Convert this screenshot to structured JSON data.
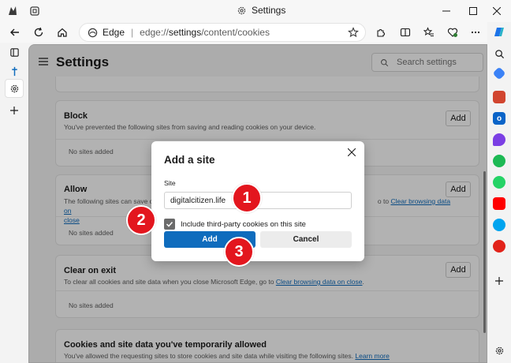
{
  "window": {
    "title": "Settings"
  },
  "addressbar": {
    "site_name": "Edge",
    "url_prefix": "edge://",
    "url_highlight": "settings",
    "url_rest": "/content/cookies"
  },
  "settings": {
    "title": "Settings",
    "search_placeholder": "Search settings"
  },
  "sections": {
    "block": {
      "title": "Block",
      "description": "You've prevented the following sites from saving and reading cookies on your device.",
      "add_label": "Add",
      "empty": "No sites added"
    },
    "allow": {
      "title": "Allow",
      "description_start": "The following sites can save c",
      "description_end": "o to ",
      "link": "Clear browsing data on",
      "link_2": "close",
      "add_label": "Add",
      "empty": "No sites added"
    },
    "clear_on_exit": {
      "title": "Clear on exit",
      "description": "To clear all cookies and site data when you close Microsoft Edge, go to ",
      "link": "Clear browsing data on close",
      "add_label": "Add",
      "empty": "No sites added"
    },
    "temporary": {
      "title": "Cookies and site data you've temporarily allowed",
      "description": "You've allowed the requesting sites to store cookies and site data while visiting the following sites. ",
      "link": "Learn more"
    }
  },
  "dialog": {
    "title": "Add a site",
    "site_label": "Site",
    "site_value": "digitalcitizen.life",
    "checkbox_label": "Include third-party cookies on this site",
    "checkbox_checked": true,
    "add_label": "Add",
    "cancel_label": "Cancel"
  },
  "markers": {
    "one": "1",
    "two": "2",
    "three": "3"
  },
  "colors": {
    "accent": "#0f6cbd",
    "marker": "#e3161e"
  }
}
